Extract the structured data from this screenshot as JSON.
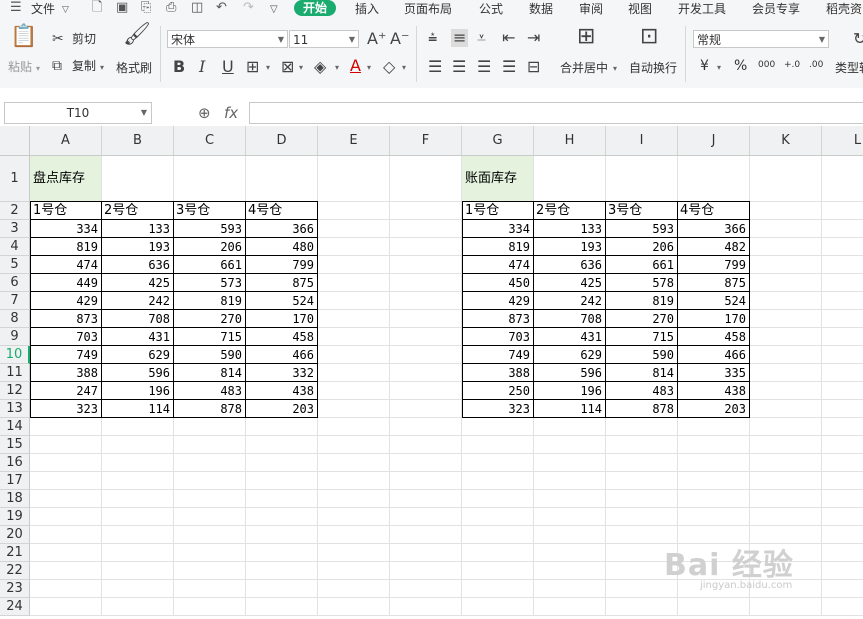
{
  "menu": {
    "file": "文件",
    "tabs": [
      "开始",
      "插入",
      "页面布局",
      "公式",
      "数据",
      "审阅",
      "视图",
      "开发工具",
      "会员专享",
      "稻壳资"
    ]
  },
  "ribbon": {
    "paste": "粘贴",
    "cut": "剪切",
    "copy": "复制",
    "format_painter": "格式刷",
    "font_name": "宋体",
    "font_size": "11",
    "merge_center": "合并居中",
    "wrap_text": "自动换行",
    "number_format": "常规",
    "currency_symbol": "¥",
    "percent_symbol": "%",
    "convert": "类型转"
  },
  "formula": {
    "name_box": "T10",
    "fx": "fx",
    "value": ""
  },
  "columns": [
    "A",
    "B",
    "C",
    "D",
    "E",
    "F",
    "G",
    "H",
    "I",
    "J",
    "K",
    "L"
  ],
  "rows": [
    "1",
    "2",
    "3",
    "4",
    "5",
    "6",
    "7",
    "8",
    "9",
    "10",
    "11",
    "12",
    "13",
    "14",
    "15",
    "16",
    "17",
    "18",
    "19",
    "20",
    "21",
    "22",
    "23",
    "24"
  ],
  "selected_row": "10",
  "tables": {
    "left": {
      "title": "盘点库存",
      "headers": [
        "1号仓",
        "2号仓",
        "3号仓",
        "4号仓"
      ],
      "rows": [
        [
          "334",
          "133",
          "593",
          "366"
        ],
        [
          "819",
          "193",
          "206",
          "480"
        ],
        [
          "474",
          "636",
          "661",
          "799"
        ],
        [
          "449",
          "425",
          "573",
          "875"
        ],
        [
          "429",
          "242",
          "819",
          "524"
        ],
        [
          "873",
          "708",
          "270",
          "170"
        ],
        [
          "703",
          "431",
          "715",
          "458"
        ],
        [
          "749",
          "629",
          "590",
          "466"
        ],
        [
          "388",
          "596",
          "814",
          "332"
        ],
        [
          "247",
          "196",
          "483",
          "438"
        ],
        [
          "323",
          "114",
          "878",
          "203"
        ]
      ]
    },
    "right": {
      "title": "账面库存",
      "headers": [
        "1号仓",
        "2号仓",
        "3号仓",
        "4号仓"
      ],
      "rows": [
        [
          "334",
          "133",
          "593",
          "366"
        ],
        [
          "819",
          "193",
          "206",
          "482"
        ],
        [
          "474",
          "636",
          "661",
          "799"
        ],
        [
          "450",
          "425",
          "578",
          "875"
        ],
        [
          "429",
          "242",
          "819",
          "524"
        ],
        [
          "873",
          "708",
          "270",
          "170"
        ],
        [
          "703",
          "431",
          "715",
          "458"
        ],
        [
          "749",
          "629",
          "590",
          "466"
        ],
        [
          "388",
          "596",
          "814",
          "335"
        ],
        [
          "250",
          "196",
          "483",
          "438"
        ],
        [
          "323",
          "114",
          "878",
          "203"
        ]
      ]
    }
  },
  "watermark": {
    "main": "Bai 经验",
    "sub": "jingyan.baidu.com"
  },
  "colors": {
    "accent": "#1aab6e",
    "title_fill": "#e4f2de"
  }
}
